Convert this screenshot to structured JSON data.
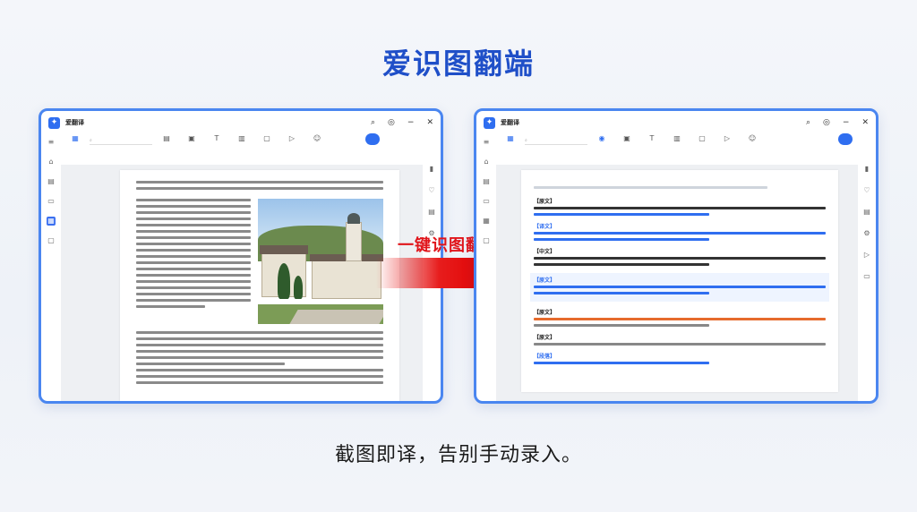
{
  "headline": "爱识图翻端",
  "tagline": "截图即译，告别手动录入。",
  "arrow_label": "一键识图翻译",
  "colors": {
    "accent": "#2f6ef0",
    "arrow": "#e0141a",
    "headline": "#1f4fc8",
    "window_border": "#4a86f0"
  },
  "left_window": {
    "app_name": "爱翻译",
    "file_name": "",
    "pill_label": "",
    "tools": [
      {
        "icon": "grid-icon",
        "label": ""
      },
      {
        "icon": "doc-icon",
        "label": ""
      },
      {
        "icon": "image-icon",
        "label": ""
      },
      {
        "icon": "text-icon",
        "label": ""
      },
      {
        "icon": "chat-icon",
        "label": ""
      },
      {
        "icon": "play-icon",
        "label": ""
      },
      {
        "icon": "emoji-icon",
        "label": ""
      }
    ]
  },
  "right_window": {
    "app_name": "爱翻译",
    "file_name": "",
    "pill_label": "",
    "paragraphs": [
      {
        "tag": "【原文】",
        "text": "",
        "cls": "c-dark"
      },
      {
        "tag": "【译文】",
        "text": "",
        "cls": "c-blue"
      },
      {
        "tag": "【中文】",
        "text": "",
        "cls": "c-dark"
      },
      {
        "tag": "【原文】",
        "text": "",
        "cls": "c-blue"
      },
      {
        "tag": "【原文】",
        "text": "",
        "cls": "c-orange"
      },
      {
        "tag": "【原文】",
        "text": "",
        "cls": "c-dark"
      },
      {
        "tag": "【段落】",
        "text": "",
        "cls": "c-blue"
      }
    ]
  }
}
